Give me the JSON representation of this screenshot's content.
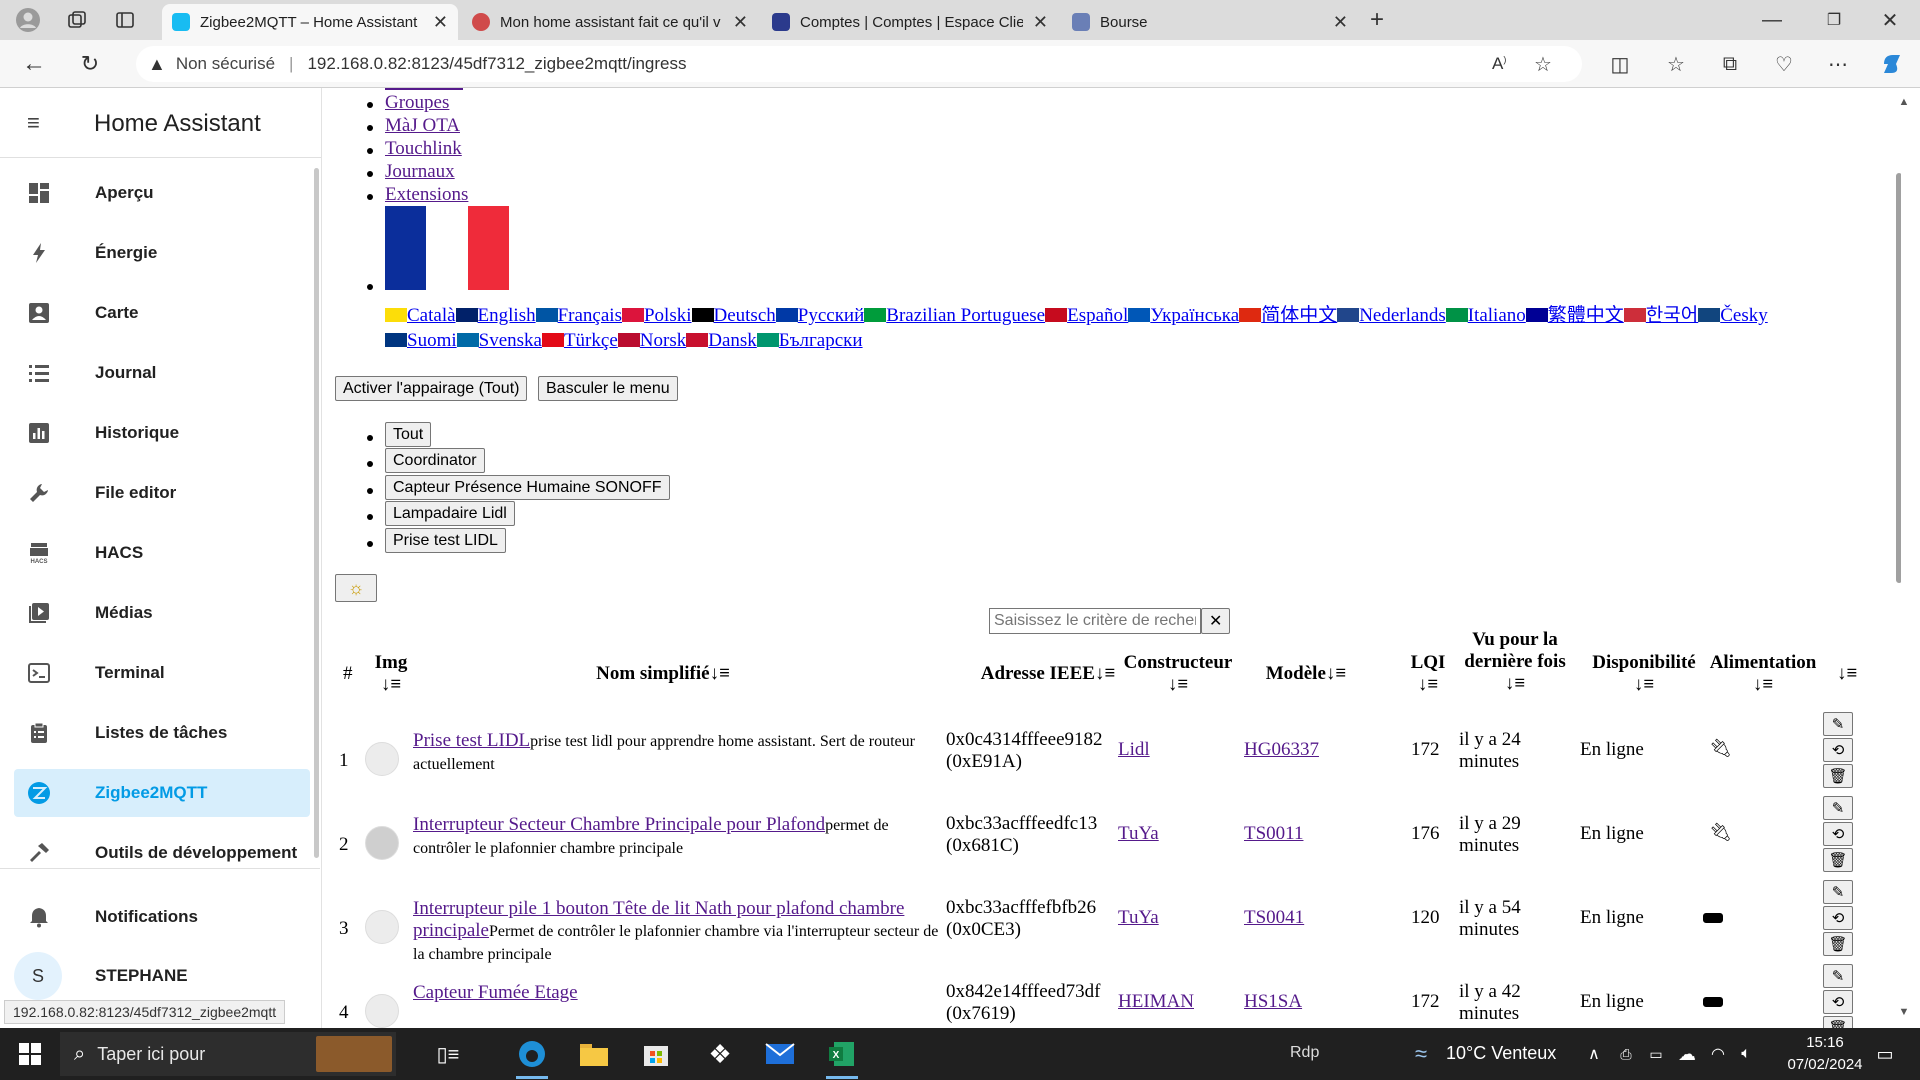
{
  "browser": {
    "tabs": [
      {
        "title": "Zigbee2MQTT – Home Assistant",
        "active": true,
        "color": "#18bcf2"
      },
      {
        "title": "Mon home assistant fait ce qu'il v",
        "active": false,
        "color": "#d04a4a"
      },
      {
        "title": "Comptes | Comptes | Espace Clie",
        "active": false,
        "color": "#2b3a8c"
      },
      {
        "title": "Bourse",
        "active": false,
        "color": "#6a7fb6"
      }
    ],
    "security": "Non sécurisé",
    "url": "192.168.0.82:8123/45df7312_zigbee2mqtt/ingress",
    "status_url": "192.168.0.82:8123/45df7312_zigbee2mqtt"
  },
  "sidebar": {
    "title": "Home Assistant",
    "items": [
      {
        "label": "Aperçu",
        "icon": "dashboard-icon"
      },
      {
        "label": "Énergie",
        "icon": "lightning-icon"
      },
      {
        "label": "Carte",
        "icon": "map-person-icon"
      },
      {
        "label": "Journal",
        "icon": "list-icon"
      },
      {
        "label": "Historique",
        "icon": "chart-icon"
      },
      {
        "label": "File editor",
        "icon": "wrench-icon"
      },
      {
        "label": "HACS",
        "icon": "hacs-icon"
      },
      {
        "label": "Médias",
        "icon": "play-icon"
      },
      {
        "label": "Terminal",
        "icon": "terminal-icon"
      },
      {
        "label": "Listes de tâches",
        "icon": "clipboard-icon"
      },
      {
        "label": "Zigbee2MQTT",
        "icon": "zigbee-icon",
        "selected": true
      },
      {
        "label": "Outils de développement",
        "icon": "hammer-icon"
      }
    ],
    "notifications": "Notifications",
    "user_initial": "S",
    "user": "STEPHANE"
  },
  "z2m": {
    "nav_links": [
      "Groupes",
      "MàJ OTA",
      "Touchlink",
      "Journaux",
      "Extensions"
    ],
    "languages_row1": [
      "Català",
      "English",
      "Français",
      "Polski",
      "Deutsch",
      "Русский",
      "Brazilian Portuguese",
      "Español",
      "Українська",
      "简体中文",
      "Nederlands",
      "Italiano",
      "繁體中文",
      "한국어",
      "Česky"
    ],
    "languages_row2": [
      "Suomi",
      "Svenska",
      "Türkçe",
      "Norsk",
      "Dansk",
      "Български"
    ],
    "permit_join": "Activer l'appairage (Tout)",
    "toggle_menu": "Basculer le menu",
    "permit_targets": [
      "Tout",
      "Coordinator",
      "Capteur Présence Humaine SONOFF",
      "Lampadaire Lidl",
      "Prise test LIDL"
    ],
    "search_placeholder": "Saisissez le critère de recherche",
    "clear": "✕",
    "columns": {
      "num": "#",
      "img": "Img",
      "name": "Nom simplifié",
      "ieee": "Adresse IEEE",
      "vendor": "Constructeur",
      "model": "Modèle",
      "lqi": "LQI",
      "last_seen": "Vu pour la dernière fois",
      "availability": "Disponibilité",
      "power": "Alimentation"
    },
    "devices": [
      {
        "num": "1",
        "name": "Prise test LIDL",
        "desc": "prise test lidl pour apprendre home assistant. Sert de routeur actuellement",
        "ieee": "0x0c4314fffeee9182",
        "nwk": "(0xE91A)",
        "vendor": "Lidl",
        "model": "HG06337",
        "lqi": "172",
        "seen1": "il y a 24",
        "seen2": "minutes",
        "avail": "En ligne",
        "power": "mains"
      },
      {
        "num": "2",
        "name": "Interrupteur Secteur Chambre Principale pour Plafond",
        "desc": "permet de contrôler le plafonnier chambre principale",
        "ieee": "0xbc33acfffeedfc13",
        "nwk": "(0x681C)",
        "vendor": "TuYa",
        "model": "TS0011",
        "lqi": "176",
        "seen1": "il y a 29",
        "seen2": "minutes",
        "avail": "En ligne",
        "power": "mains"
      },
      {
        "num": "3",
        "name": "Interrupteur pile 1 bouton Tête de lit Nath pour plafond chambre principale",
        "desc": "Permet de contrôler le plafonnier chambre via l'interrupteur secteur de la chambre principale",
        "ieee": "0xbc33acfffefbfb26",
        "nwk": "(0x0CE3)",
        "vendor": "TuYa",
        "model": "TS0041",
        "lqi": "120",
        "seen1": "il y a 54",
        "seen2": "minutes",
        "avail": "En ligne",
        "power": "battery"
      },
      {
        "num": "4",
        "name": "Capteur Fumée Etage",
        "desc": "",
        "ieee": "0x842e14fffeed73df",
        "nwk": "(0x7619)",
        "vendor": "HEIMAN",
        "model": "HS1SA",
        "lqi": "172",
        "seen1": "il y a 42",
        "seen2": "minutes",
        "avail": "En ligne",
        "power": "battery"
      }
    ]
  },
  "taskbar": {
    "search": "Taper ici pour",
    "rdp": "Rdp",
    "weather": "10°C Venteux",
    "time": "15:16",
    "date": "07/02/2024"
  }
}
